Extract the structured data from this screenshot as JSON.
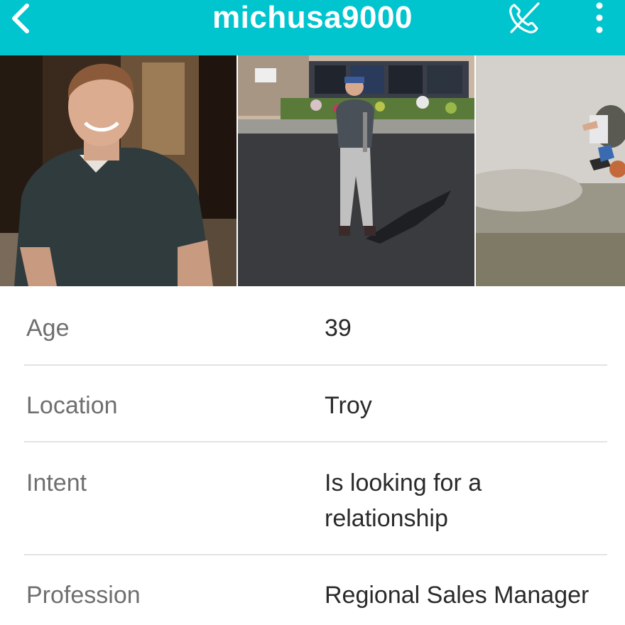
{
  "header": {
    "title": "michusa9000",
    "background_color": "#00c4ce",
    "back_icon": "chevron-left-icon",
    "call_icon": "phone-off-icon",
    "more_icon": "more-vertical-icon"
  },
  "photos": [
    {
      "subject": "man-smiling-dark-polo"
    },
    {
      "subject": "man-standing-parking-lot"
    },
    {
      "subject": "skydiver-in-sky"
    }
  ],
  "profile": {
    "age": {
      "label": "Age",
      "value": "39"
    },
    "location": {
      "label": "Location",
      "value": "Troy"
    },
    "intent": {
      "label": "Intent",
      "value_line1": "Is looking for a",
      "value_line2": "relationship"
    },
    "profession": {
      "label": "Profession",
      "value": "Regional Sales Manager"
    }
  }
}
